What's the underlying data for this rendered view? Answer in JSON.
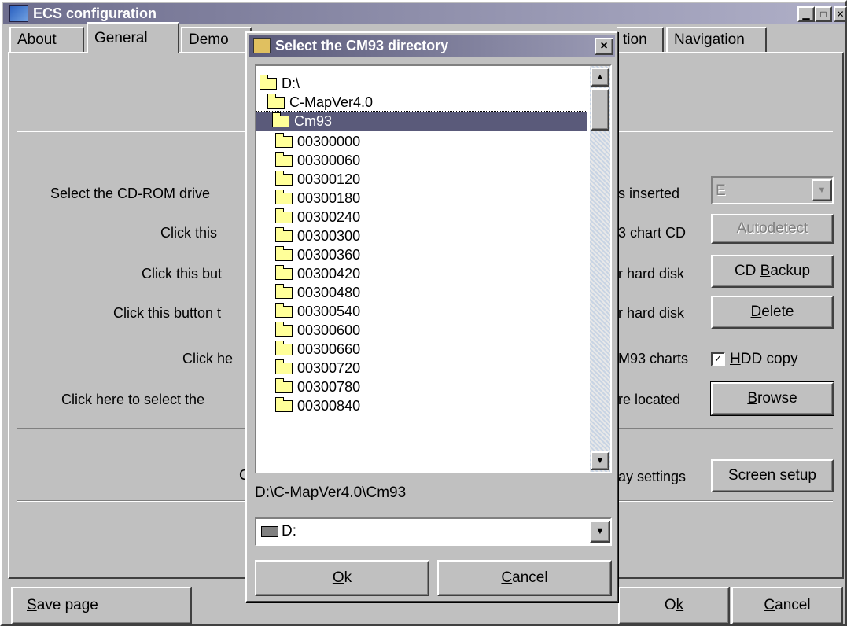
{
  "window": {
    "title": "ECS configuration"
  },
  "tabs": [
    "About",
    "General",
    "Demo",
    "tion",
    "Navigation"
  ],
  "rows": [
    {
      "left": "Select the CD-ROM drive",
      "right": "s inserted"
    },
    {
      "left": "Click this",
      "right": "3 chart CD"
    },
    {
      "left": "Click this but",
      "right": "r hard disk"
    },
    {
      "left": "Click this button t",
      "right": "r hard disk"
    },
    {
      "left": "Click he",
      "right": "M93 charts"
    },
    {
      "left": "Click here to select the",
      "right": "re located"
    },
    {
      "left": "C",
      "right": "ay settings"
    }
  ],
  "drive_select": {
    "value": "E"
  },
  "buttons": {
    "autodetect": "Autodetect",
    "cd_backup_pre": "CD ",
    "cd_backup_u": "B",
    "cd_backup_post": "ackup",
    "delete_u": "D",
    "delete_post": "elete",
    "hdd_u": "H",
    "hdd_post": "DD copy",
    "browse_u": "B",
    "browse_post": "rowse",
    "screen_pre": "Sc",
    "screen_u": "r",
    "screen_post": "een setup",
    "save_u": "S",
    "save_post": "ave page",
    "ok_pre": "O",
    "ok_u": "k",
    "cancel_u": "C",
    "cancel_post": "ancel"
  },
  "dialog": {
    "title": "Select the CM93 directory",
    "close": "×",
    "tree": [
      {
        "label": "D:\\",
        "open": true
      },
      {
        "label": "C-MapVer4.0",
        "open": true
      },
      {
        "label": "Cm93",
        "open": true,
        "selected": true
      }
    ],
    "folders": [
      "00300000",
      "00300060",
      "00300120",
      "00300180",
      "00300240",
      "00300300",
      "00300360",
      "00300420",
      "00300480",
      "00300540",
      "00300600",
      "00300660",
      "00300720",
      "00300780",
      "00300840"
    ],
    "path": "D:\\C-MapVer4.0\\Cm93",
    "drive": "D:",
    "ok_u": "O",
    "ok_post": "k",
    "cancel_u": "C",
    "cancel_post": "ancel"
  },
  "colors": {
    "titlebar": "#6e6e8e",
    "selection": "#5a5a7a",
    "folder": "#ffff99"
  }
}
